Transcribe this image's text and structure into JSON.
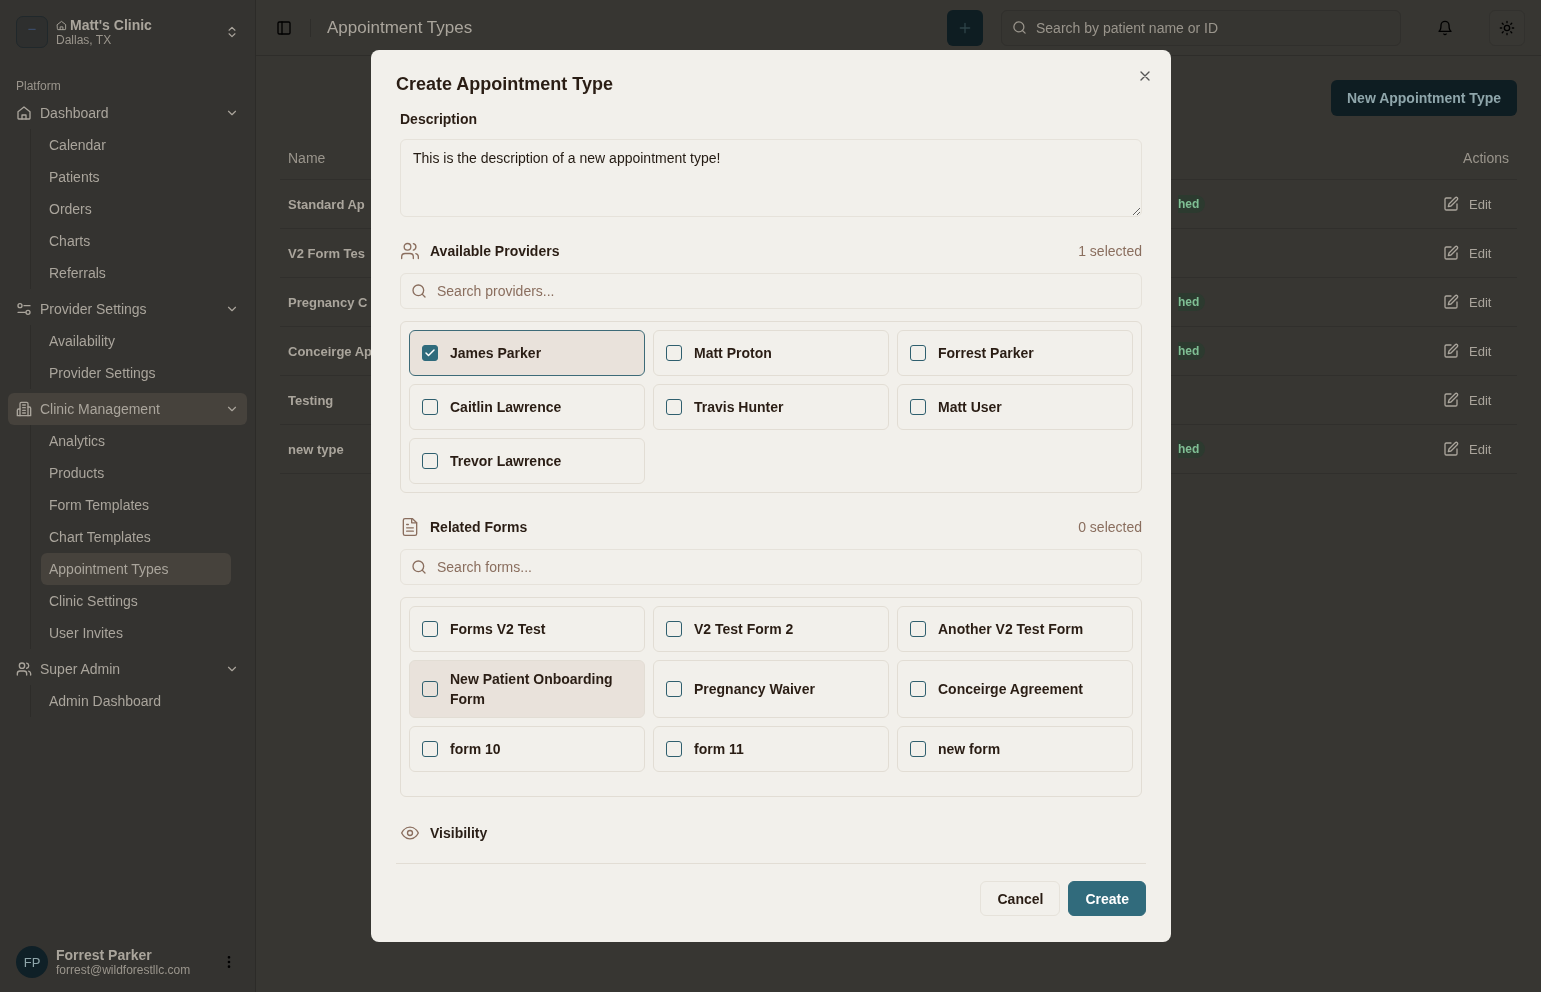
{
  "clinic": {
    "name": "Matt's Clinic",
    "location": "Dallas, TX"
  },
  "sidebar": {
    "section_label": "Platform",
    "groups": [
      {
        "label": "Dashboard",
        "expanded": true,
        "selected": false,
        "children": [
          {
            "label": "Calendar",
            "selected": false
          },
          {
            "label": "Patients",
            "selected": false
          },
          {
            "label": "Orders",
            "selected": false
          },
          {
            "label": "Charts",
            "selected": false
          },
          {
            "label": "Referrals",
            "selected": false
          }
        ]
      },
      {
        "label": "Provider Settings",
        "expanded": true,
        "selected": false,
        "children": [
          {
            "label": "Availability",
            "selected": false
          },
          {
            "label": "Provider Settings",
            "selected": false
          }
        ]
      },
      {
        "label": "Clinic Management",
        "expanded": true,
        "selected": true,
        "children": [
          {
            "label": "Analytics",
            "selected": false
          },
          {
            "label": "Products",
            "selected": false
          },
          {
            "label": "Form Templates",
            "selected": false
          },
          {
            "label": "Chart Templates",
            "selected": false
          },
          {
            "label": "Appointment Types",
            "selected": true
          },
          {
            "label": "Clinic Settings",
            "selected": false
          },
          {
            "label": "User Invites",
            "selected": false
          }
        ]
      },
      {
        "label": "Super Admin",
        "expanded": true,
        "selected": false,
        "children": [
          {
            "label": "Admin Dashboard",
            "selected": false
          }
        ]
      }
    ],
    "user": {
      "initials": "FP",
      "name": "Forrest Parker",
      "email": "forrest@wildforestllc.com"
    }
  },
  "header": {
    "title": "Appointment Types",
    "search_placeholder": "Search by patient name or ID"
  },
  "page": {
    "new_button": "New Appointment Type",
    "table": {
      "columns": [
        "Name",
        "Actions"
      ],
      "rows": [
        {
          "name": "Standard Ap",
          "status": "hed",
          "action": "Edit"
        },
        {
          "name": "V2 Form Tes",
          "action": "Edit"
        },
        {
          "name": "Pregnancy C",
          "status": "hed",
          "action": "Edit"
        },
        {
          "name": "Conceirge Ap",
          "status": "hed",
          "action": "Edit"
        },
        {
          "name": "Testing",
          "action": "Edit"
        },
        {
          "name": "new type",
          "status": "hed",
          "action": "Edit"
        }
      ]
    }
  },
  "dialog": {
    "title": "Create Appointment Type",
    "description_label": "Description",
    "description_value": "This is the description of a new appointment type!",
    "providers": {
      "label": "Available Providers",
      "count": "1 selected",
      "search_placeholder": "Search providers...",
      "items": [
        {
          "label": "James Parker",
          "checked": true,
          "hovered": false
        },
        {
          "label": "Matt Proton",
          "checked": false,
          "hovered": false
        },
        {
          "label": "Forrest Parker",
          "checked": false,
          "hovered": false
        },
        {
          "label": "Caitlin Lawrence",
          "checked": false,
          "hovered": false
        },
        {
          "label": "Travis Hunter",
          "checked": false,
          "hovered": false
        },
        {
          "label": "Matt User",
          "checked": false,
          "hovered": false
        },
        {
          "label": "Trevor Lawrence",
          "checked": false,
          "hovered": false
        }
      ]
    },
    "forms": {
      "label": "Related Forms",
      "count": "0 selected",
      "search_placeholder": "Search forms...",
      "items": [
        {
          "label": "Forms V2 Test",
          "checked": false,
          "hovered": false
        },
        {
          "label": "V2 Test Form 2",
          "checked": false,
          "hovered": false
        },
        {
          "label": "Another V2 Test Form",
          "checked": false,
          "hovered": false
        },
        {
          "label": "New Patient Onboarding Form",
          "checked": false,
          "hovered": true
        },
        {
          "label": "Pregnancy Waiver",
          "checked": false,
          "hovered": false
        },
        {
          "label": "Conceirge Agreement",
          "checked": false,
          "hovered": false
        },
        {
          "label": "form 10",
          "checked": false,
          "hovered": false
        },
        {
          "label": "form 11",
          "checked": false,
          "hovered": false
        },
        {
          "label": "new form",
          "checked": false,
          "hovered": false
        }
      ]
    },
    "visibility_label": "Visibility",
    "buttons": [
      {
        "label": "Cancel",
        "kind": "secondary"
      },
      {
        "label": "Create",
        "kind": "primary"
      }
    ]
  }
}
